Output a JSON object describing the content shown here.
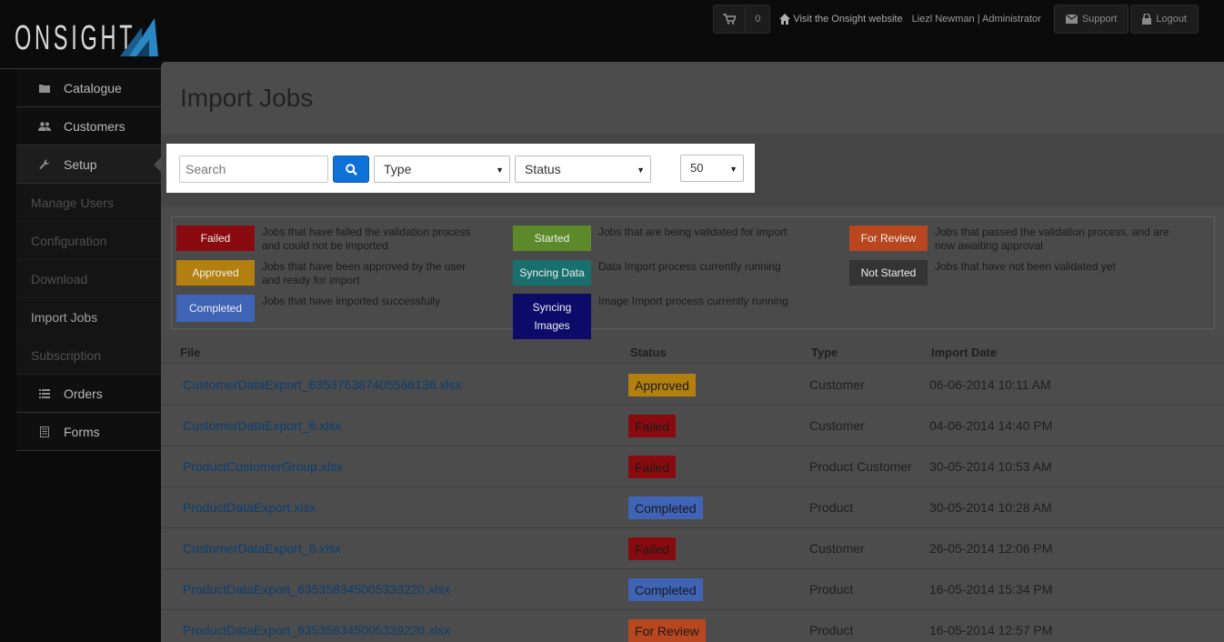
{
  "brand": {
    "logo_text": "ONSIGHT"
  },
  "topbar": {
    "cart_count": "0",
    "visit_link": "Visit the Onsight website",
    "user": "Liezl Newman | Administrator",
    "support_label": "Support",
    "logout_label": "Logout"
  },
  "sidebar": {
    "items": [
      {
        "label": "Catalogue",
        "icon": "folder-icon"
      },
      {
        "label": "Customers",
        "icon": "users-icon"
      },
      {
        "label": "Setup",
        "icon": "wrench-icon"
      }
    ],
    "setup_sub": [
      "Manage Users",
      "Configuration",
      "Download",
      "Import Jobs",
      "Subscription"
    ],
    "bottom_items": [
      {
        "label": "Orders",
        "icon": "list-icon"
      },
      {
        "label": "Forms",
        "icon": "document-icon"
      }
    ]
  },
  "page": {
    "title": "Import Jobs"
  },
  "filters": {
    "search_placeholder": "Search",
    "type_value": "Type",
    "status_value": "Status",
    "page_size": "50"
  },
  "legend": [
    {
      "badge": "Failed",
      "color": "#8a0b0f",
      "text": "Jobs that have failed the validation process and could not be imported"
    },
    {
      "badge": "Approved",
      "color": "#b3800f",
      "text": "Jobs that have been approved by the user and ready for import"
    },
    {
      "badge": "Completed",
      "color": "#3f63b5",
      "text": "Jobs that have imported successfully"
    },
    {
      "badge": "Started",
      "color": "#5c8a2a",
      "text": "Jobs that are being validated for import"
    },
    {
      "badge": "Syncing Data",
      "color": "#176f6e",
      "text": "Data Import process currently running"
    },
    {
      "badge": "Syncing Images",
      "color": "#0c0b6a",
      "text": "Image Import process currently running"
    },
    {
      "badge": "For Review",
      "color": "#b8461e",
      "text": "Jobs that passed the validation process, and are now awaiting approval"
    },
    {
      "badge": "Not Started",
      "color": "#343434",
      "text": "Jobs that have not been validated yet"
    }
  ],
  "table": {
    "headers": {
      "file": "File",
      "status": "Status",
      "type": "Type",
      "date": "Import Date"
    },
    "rows": [
      {
        "file": "CustomerDataExport_635376387405566136.xlsx",
        "status": "Approved",
        "status_color": "#b3800f",
        "type": "Customer",
        "date": "06-06-2014 10:11 AM"
      },
      {
        "file": "CustomerDataExport_6.xlsx",
        "status": "Failed",
        "status_color": "#8a0b0f",
        "type": "Customer",
        "date": "04-06-2014 14:40 PM"
      },
      {
        "file": "ProductCustomerGroup.xlsx",
        "status": "Failed",
        "status_color": "#8a0b0f",
        "type": "Product Customer",
        "date": "30-05-2014 10:53 AM"
      },
      {
        "file": "ProductDataExport.xlsx",
        "status": "Completed",
        "status_color": "#3f63b5",
        "type": "Product",
        "date": "30-05-2014 10:28 AM"
      },
      {
        "file": "CustomerDataExport_6.xlsx",
        "status": "Failed",
        "status_color": "#8a0b0f",
        "type": "Customer",
        "date": "26-05-2014 12:06 PM"
      },
      {
        "file": "ProductDataExport_635358345005339220.xlsx",
        "status": "Completed",
        "status_color": "#3f63b5",
        "type": "Product",
        "date": "16-05-2014 15:34 PM"
      },
      {
        "file": "ProductDataExport_635358345005339220.xlsx",
        "status": "For Review",
        "status_color": "#b8461e",
        "type": "Product",
        "date": "16-05-2014 12:57 PM"
      }
    ]
  }
}
